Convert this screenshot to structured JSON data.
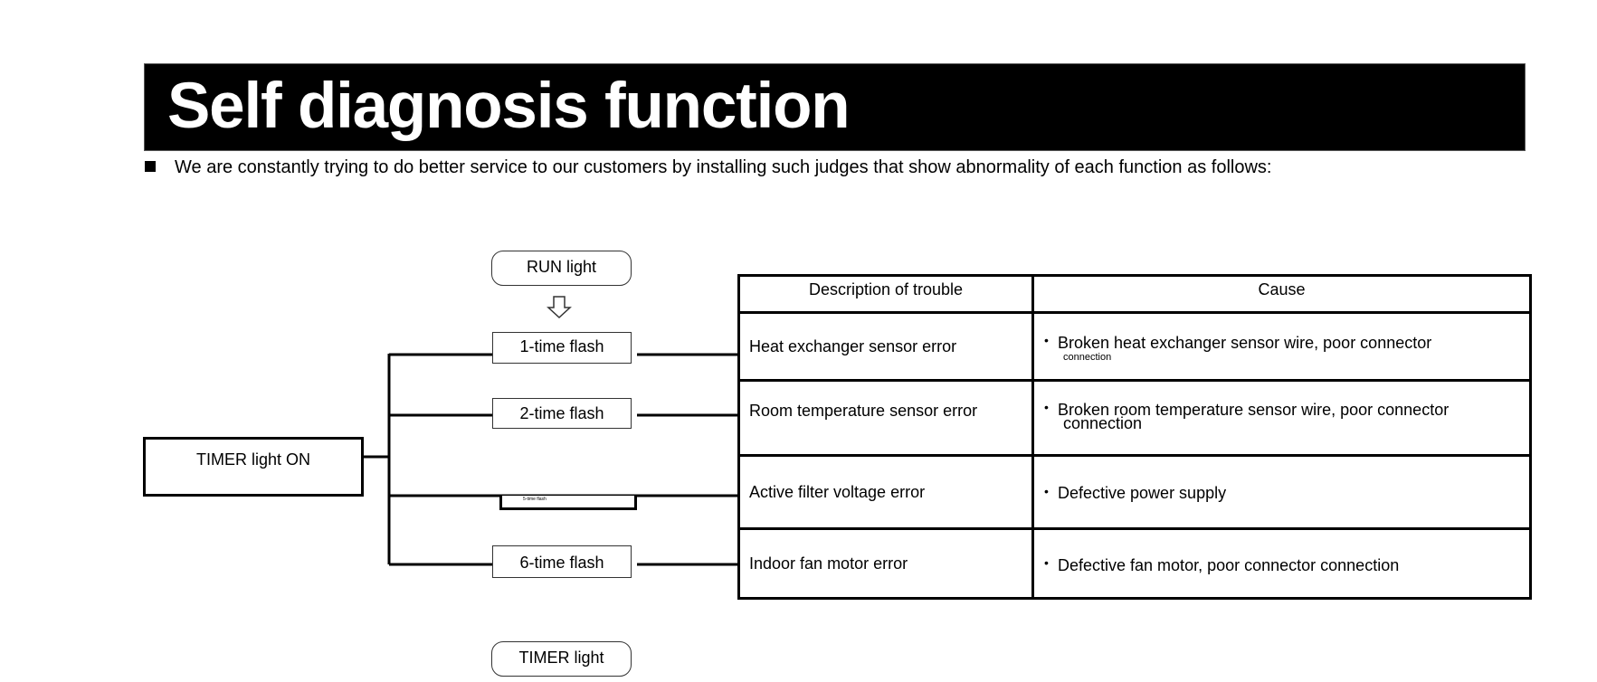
{
  "header": {
    "title": "Self diagnosis function",
    "intro": "We are constantly trying to do better service to our customers by installing such judges that show abnormality of each function as follows:"
  },
  "diagram": {
    "top_label": "RUN light",
    "arrow_icon": "down-arrow-outline",
    "source_label": "TIMER light ON",
    "bottom_label": "TIMER light",
    "flashes": [
      {
        "label": "1-time flash"
      },
      {
        "label": "2-time flash"
      },
      {
        "label": "5-time flash"
      },
      {
        "label": "6-time flash"
      }
    ]
  },
  "table": {
    "headers": [
      "Description of trouble",
      "Cause"
    ],
    "rows": [
      {
        "description": "Heat exchanger sensor error",
        "cause": "Broken heat exchanger sensor wire, poor connector",
        "cause_cont": "connection"
      },
      {
        "description": "Room temperature sensor error",
        "cause": "Broken room temperature sensor wire, poor connector",
        "cause_cont": "connection"
      },
      {
        "description": "Active filter voltage error",
        "cause": "Defective power supply",
        "cause_cont": ""
      },
      {
        "description": "Indoor fan motor error",
        "cause": "Defective fan motor, poor connector connection",
        "cause_cont": ""
      }
    ],
    "bullet": "•"
  }
}
